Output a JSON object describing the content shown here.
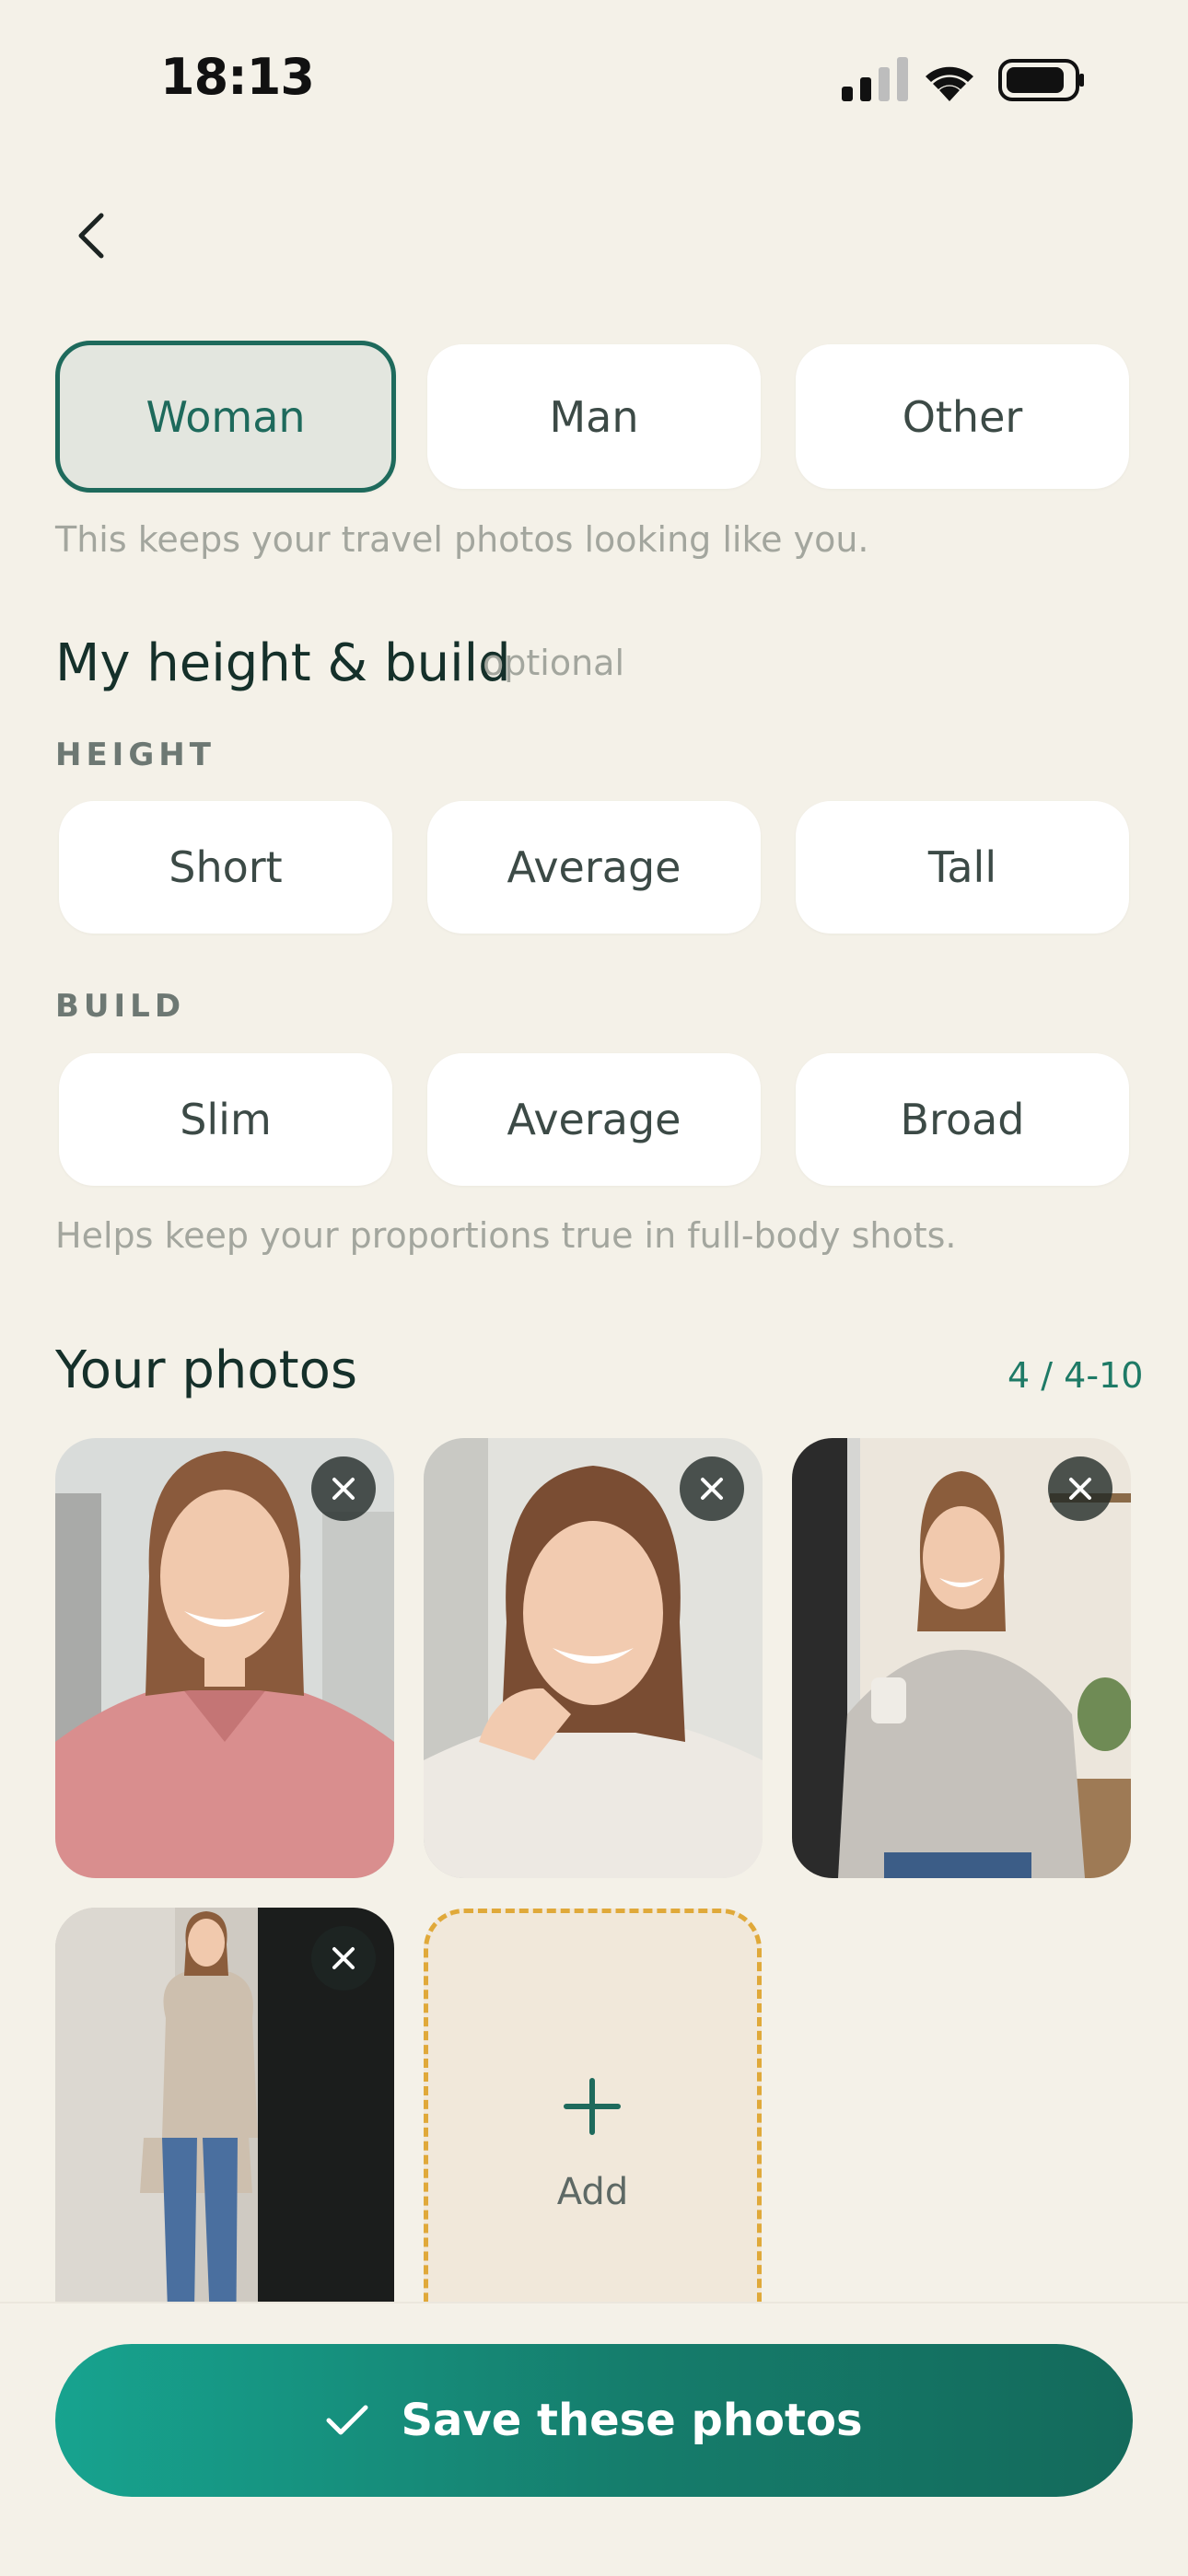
{
  "status_bar": {
    "time": "18:13"
  },
  "gender": {
    "options": [
      {
        "label": "Woman",
        "selected": true
      },
      {
        "label": "Man",
        "selected": false
      },
      {
        "label": "Other",
        "selected": false
      }
    ],
    "hint": "This keeps your travel photos looking like you."
  },
  "height_build": {
    "title": "My height & build",
    "optional": "optional",
    "height_label": "HEIGHT",
    "height_options": [
      "Short",
      "Average",
      "Tall"
    ],
    "build_label": "BUILD",
    "build_options": [
      "Slim",
      "Average",
      "Broad"
    ],
    "hint": "Helps keep your proportions true in full-body shots."
  },
  "photos": {
    "title": "Your photos",
    "counter": "4 / 4-10",
    "add_label": "Add"
  },
  "save_button": {
    "label": "Save these photos"
  },
  "colors": {
    "accent": "#1e6a5c",
    "button": "#157c6b",
    "background": "#f4f1e8",
    "add_border": "#e0a93a"
  }
}
